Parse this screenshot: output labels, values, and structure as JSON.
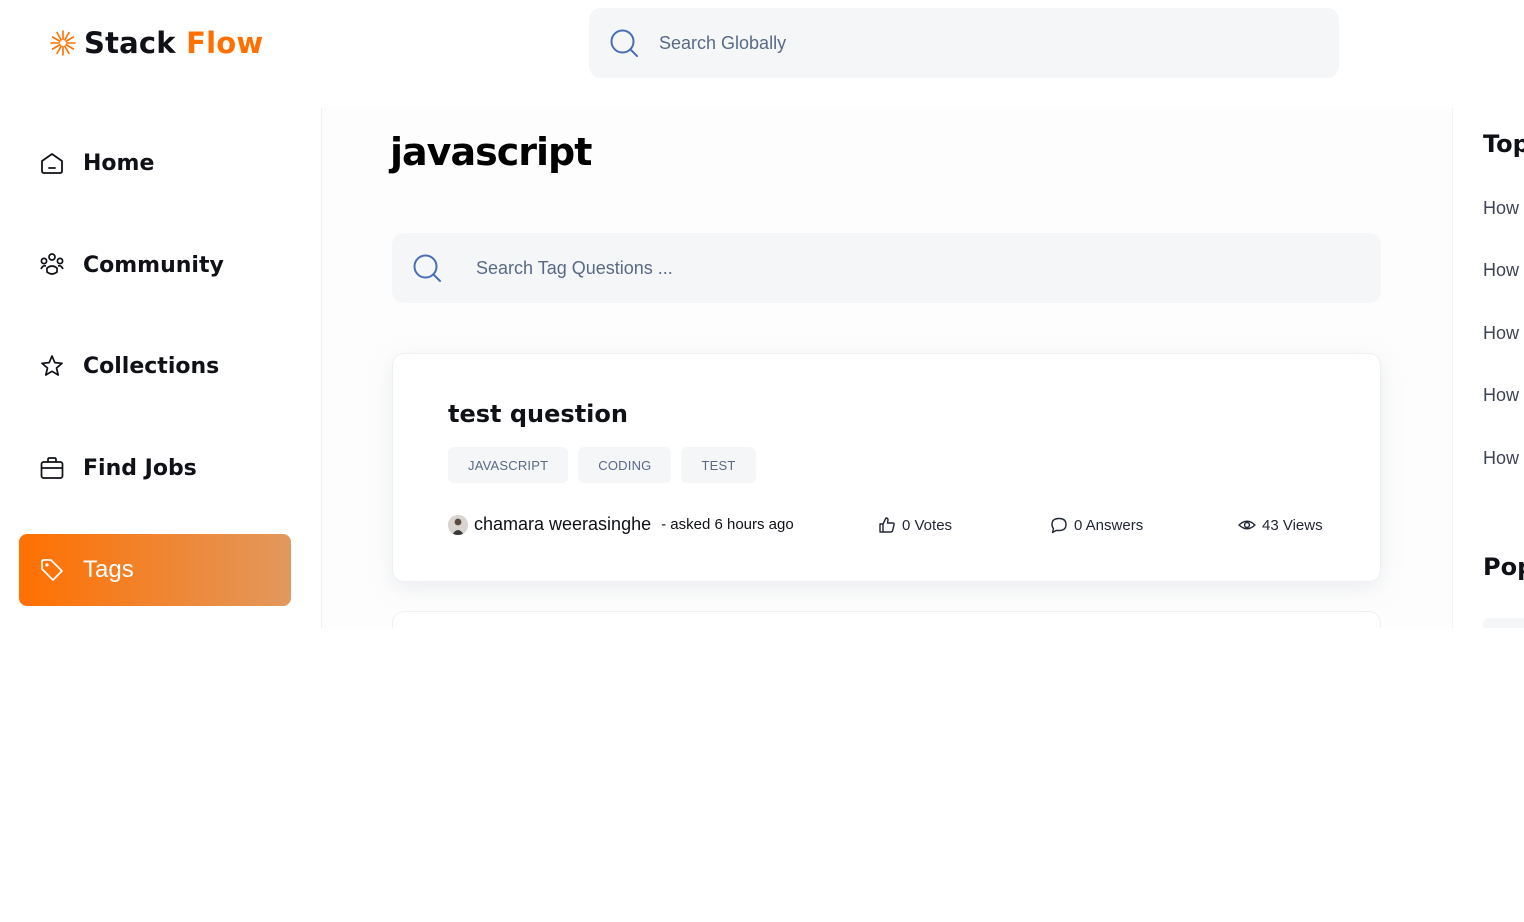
{
  "header": {
    "logo_part1": "Stack",
    "logo_part2": "Flow",
    "search_placeholder": "Search Globally"
  },
  "sidebar": {
    "items": [
      {
        "label": "Home",
        "icon": "home-icon"
      },
      {
        "label": "Community",
        "icon": "community-icon"
      },
      {
        "label": "Collections",
        "icon": "star-icon"
      },
      {
        "label": "Find Jobs",
        "icon": "briefcase-icon"
      },
      {
        "label": "Tags",
        "icon": "tag-icon",
        "active": true
      }
    ]
  },
  "main": {
    "title": "javascript",
    "search_placeholder": "Search Tag Questions ...",
    "questions": [
      {
        "title": "test question",
        "tags": [
          "JAVASCRIPT",
          "CODING",
          "TEST"
        ],
        "author": "chamara weerasinghe",
        "asked": "- asked 6 hours ago",
        "votes": "0 Votes",
        "answers": "0 Answers",
        "views": "43 Views"
      }
    ]
  },
  "rightbar": {
    "top_heading": "Top",
    "questions": [
      "How t",
      "How t",
      "How t",
      "How t",
      "How t"
    ],
    "popular_heading": "Pop"
  },
  "colors": {
    "accent": "#ff7000",
    "accent_gradient_end": "#e2985e",
    "search_bg": "#f4f6f8",
    "muted_text": "#5a6a85"
  }
}
